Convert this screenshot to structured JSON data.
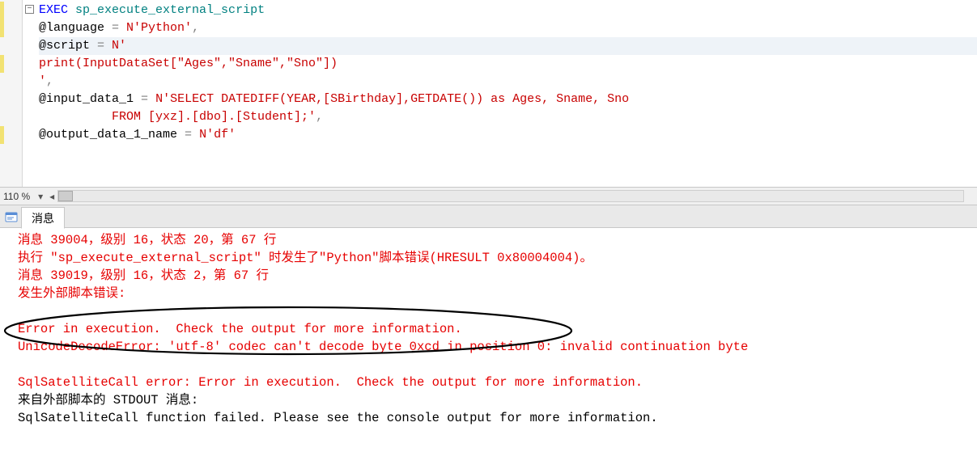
{
  "editor": {
    "fold_glyph": "−",
    "lines": [
      {
        "segments": [
          {
            "cls": "kw",
            "text": "EXEC"
          },
          {
            "cls": "blk",
            "text": " "
          },
          {
            "cls": "sys",
            "text": "sp_execute_external_script"
          }
        ]
      },
      {
        "segments": [
          {
            "cls": "blk",
            "text": "@language "
          },
          {
            "cls": "gray",
            "text": "="
          },
          {
            "cls": "blk",
            "text": " "
          },
          {
            "cls": "red",
            "text": "N'Python'"
          },
          {
            "cls": "gray",
            "text": ","
          }
        ]
      },
      {
        "current": true,
        "segments": [
          {
            "cls": "blk",
            "text": "@script "
          },
          {
            "cls": "gray",
            "text": "="
          },
          {
            "cls": "blk",
            "text": " "
          },
          {
            "cls": "red",
            "text": "N'"
          }
        ]
      },
      {
        "segments": [
          {
            "cls": "red",
            "text": "print(InputDataSet[\"Ages\",\"Sname\",\"Sno\"])"
          }
        ]
      },
      {
        "segments": [
          {
            "cls": "red",
            "text": "'"
          },
          {
            "cls": "gray",
            "text": ","
          }
        ]
      },
      {
        "segments": [
          {
            "cls": "blk",
            "text": "@input_data_1 "
          },
          {
            "cls": "gray",
            "text": "="
          },
          {
            "cls": "blk",
            "text": " "
          },
          {
            "cls": "red",
            "text": "N'SELECT DATEDIFF(YEAR,[SBirthday],GETDATE()) as Ages, Sname, Sno"
          }
        ]
      },
      {
        "segments": [
          {
            "cls": "red",
            "text": "          FROM [yxz].[dbo].[Student];'"
          },
          {
            "cls": "gray",
            "text": ","
          }
        ]
      },
      {
        "segments": [
          {
            "cls": "blk",
            "text": "@output_data_1_name "
          },
          {
            "cls": "gray",
            "text": "="
          },
          {
            "cls": "blk",
            "text": " "
          },
          {
            "cls": "red",
            "text": "N'df'"
          }
        ]
      }
    ]
  },
  "zoom": {
    "level": "110 %"
  },
  "tab": {
    "label": "消息"
  },
  "messages": {
    "lines": [
      {
        "cls": "mred",
        "text": "消息 39004，级别 16，状态 20，第 67 行"
      },
      {
        "cls": "mred",
        "text": "执行 \"sp_execute_external_script\" 时发生了\"Python\"脚本错误(HRESULT 0x80004004)。"
      },
      {
        "cls": "mred",
        "text": "消息 39019，级别 16，状态 2，第 67 行"
      },
      {
        "cls": "mred",
        "text": "发生外部脚本错误: "
      },
      {
        "cls": "mred",
        "text": " "
      },
      {
        "cls": "mred",
        "text": "Error in execution.  Check the output for more information."
      },
      {
        "cls": "mred",
        "text": "UnicodeDecodeError: 'utf-8' codec can't decode byte 0xcd in position 0: invalid continuation byte"
      },
      {
        "cls": "mred",
        "text": " "
      },
      {
        "cls": "mred",
        "text": "SqlSatelliteCall error: Error in execution.  Check the output for more information."
      },
      {
        "cls": "mblk",
        "text": "来自外部脚本的 STDOUT 消息:"
      },
      {
        "cls": "mblk",
        "text": "SqlSatelliteCall function failed. Please see the console output for more information."
      }
    ]
  }
}
